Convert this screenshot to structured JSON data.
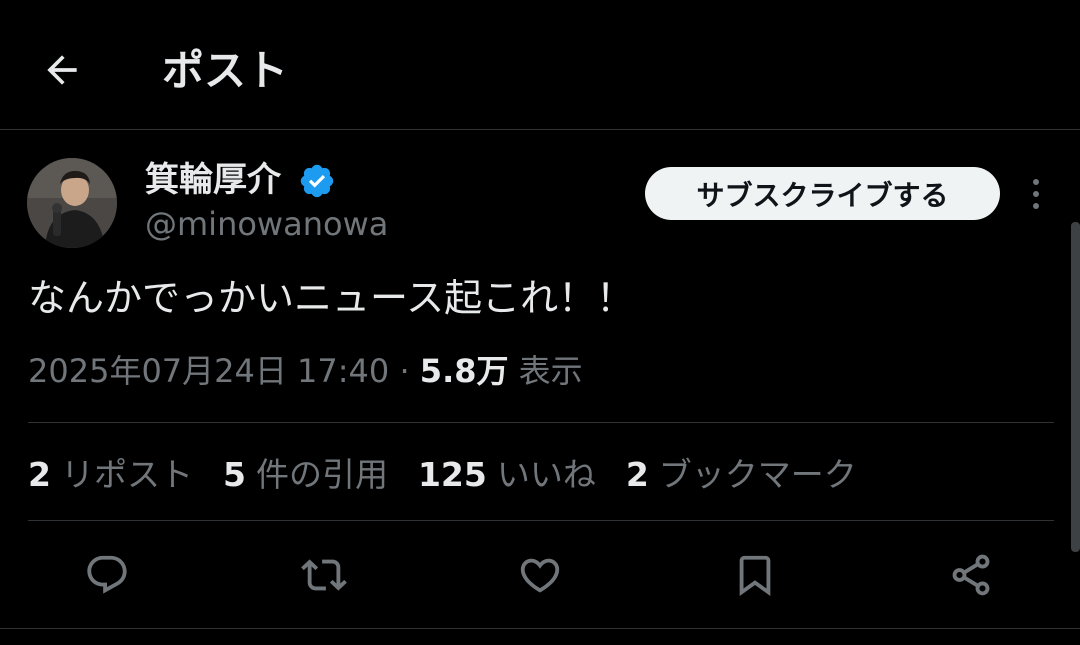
{
  "header": {
    "back_icon": "arrow-left-icon",
    "title": "ポスト"
  },
  "author": {
    "name": "箕輪厚介",
    "handle": "@minowanowa",
    "verified": true,
    "verified_color": "#1d9bf0"
  },
  "subscribe": {
    "label": "サブスクライブする"
  },
  "post": {
    "text": "なんかでっかいニュース起これ！！",
    "timestamp": "2025年07月24日 17:40",
    "separator": "·",
    "views_count": "5.8万",
    "views_label": "表示"
  },
  "stats": [
    {
      "count": "2",
      "label": "リポスト"
    },
    {
      "count": "5",
      "label": "件の引用"
    },
    {
      "count": "125",
      "label": "いいね"
    },
    {
      "count": "2",
      "label": "ブックマーク"
    }
  ],
  "actions": [
    {
      "name": "reply",
      "icon": "reply-icon"
    },
    {
      "name": "repost",
      "icon": "repost-icon"
    },
    {
      "name": "like",
      "icon": "heart-icon"
    },
    {
      "name": "bookmark",
      "icon": "bookmark-icon"
    },
    {
      "name": "share",
      "icon": "share-icon"
    }
  ],
  "colors": {
    "background": "#000000",
    "text_primary": "#e7e9ea",
    "text_secondary": "#71767b",
    "divider": "#2f3336",
    "button_bg": "#eff3f4"
  }
}
